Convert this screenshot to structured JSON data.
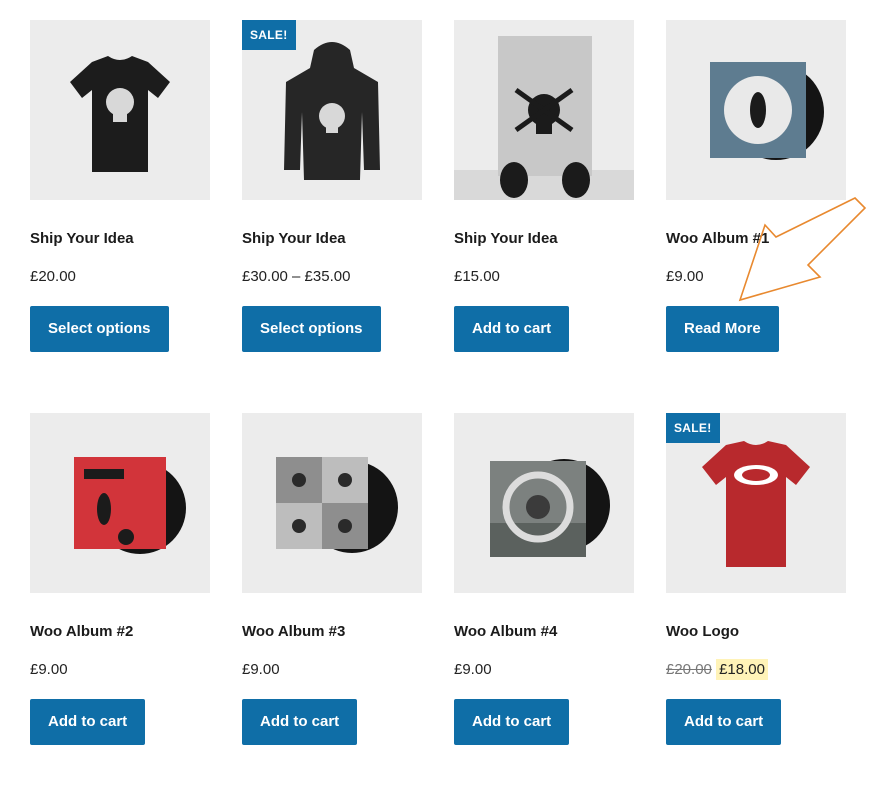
{
  "products": [
    {
      "title": "Ship Your Idea",
      "price": "£20.00",
      "button": "Select options",
      "sale": "",
      "image": "black-tshirt-icon"
    },
    {
      "title": "Ship Your Idea",
      "price": "£30.00 – £35.00",
      "button": "Select options",
      "sale": "SALE!",
      "image": "black-hoodie-icon"
    },
    {
      "title": "Ship Your Idea",
      "price": "£15.00",
      "button": "Add to cart",
      "sale": "",
      "image": "poster-icon"
    },
    {
      "title": "Woo Album #1",
      "price": "£9.00",
      "button": "Read More",
      "sale": "",
      "image": "album-blue-icon"
    },
    {
      "title": "Woo Album #2",
      "price": "£9.00",
      "button": "Add to cart",
      "sale": "",
      "image": "album-red-icon"
    },
    {
      "title": "Woo Album #3",
      "price": "£9.00",
      "button": "Add to cart",
      "sale": "",
      "image": "album-grey-icon"
    },
    {
      "title": "Woo Album #4",
      "price": "£9.00",
      "button": "Add to cart",
      "sale": "",
      "image": "album-photo-icon"
    },
    {
      "title": "Woo Logo",
      "price_old": "£20.00",
      "price_new": "£18.00",
      "button": "Add to cart",
      "sale": "SALE!",
      "image": "red-tshirt-icon"
    }
  ],
  "colors": {
    "button": "#0f6ea7",
    "thumb_bg": "#ececec",
    "annotation_arrow": "#e8892f",
    "price_highlight": "#fff3b8"
  },
  "annotation": {
    "icon": "arrow-annotation-icon"
  }
}
